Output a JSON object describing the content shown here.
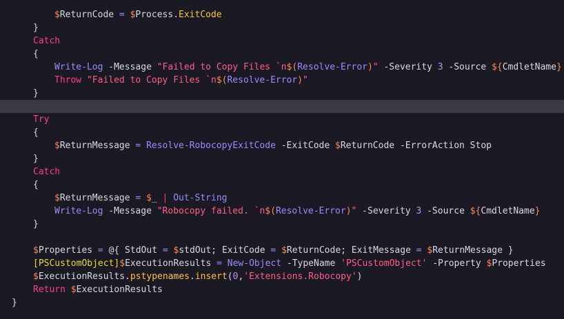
{
  "colors": {
    "background": "#1b1a24",
    "current_line": "#3b3a44",
    "plain": "#d8d8e6",
    "variable": "#ff8a5c",
    "keyword": "#ff3f7f",
    "cmdlet": "#9a8cff",
    "string": "#ff5e88",
    "number": "#c48cff",
    "property": "#ffc246",
    "type": "#e9d83a",
    "operator": "#9a8cff"
  },
  "lines": [
    [
      {
        "t": "$",
        "c": "variable"
      },
      {
        "t": "ReturnCode ",
        "c": "plain"
      },
      {
        "t": "= ",
        "c": "operator"
      },
      {
        "t": "$",
        "c": "variable"
      },
      {
        "t": "Process",
        "c": "plain"
      },
      {
        "t": ".",
        "c": "plain"
      },
      {
        "t": "ExitCode",
        "c": "property"
      }
    ],
    [
      {
        "t": "}",
        "c": "plain"
      }
    ],
    [
      {
        "t": "Catch",
        "c": "keyword"
      }
    ],
    [
      {
        "t": "{",
        "c": "plain"
      }
    ],
    [
      {
        "t": "Write-Log ",
        "c": "cmdlet"
      },
      {
        "t": "-Message ",
        "c": "plain"
      },
      {
        "t": "\"Failed to Copy Files `n",
        "c": "string"
      },
      {
        "t": "$(",
        "c": "variable"
      },
      {
        "t": "Resolve-Error",
        "c": "cmdlet"
      },
      {
        "t": ")",
        "c": "variable"
      },
      {
        "t": "\" ",
        "c": "string"
      },
      {
        "t": "-Severity ",
        "c": "plain"
      },
      {
        "t": "3 ",
        "c": "number"
      },
      {
        "t": "-Source ",
        "c": "plain"
      },
      {
        "t": "${",
        "c": "variable"
      },
      {
        "t": "CmdletName",
        "c": "plain"
      },
      {
        "t": "}",
        "c": "variable"
      }
    ],
    [
      {
        "t": "Throw ",
        "c": "keyword"
      },
      {
        "t": "\"Failed to Copy Files `n",
        "c": "string"
      },
      {
        "t": "$(",
        "c": "variable"
      },
      {
        "t": "Resolve-Error",
        "c": "cmdlet"
      },
      {
        "t": ")",
        "c": "variable"
      },
      {
        "t": "\"",
        "c": "string"
      }
    ],
    [
      {
        "t": "}",
        "c": "plain"
      }
    ],
    [],
    [
      {
        "t": "Try",
        "c": "keyword"
      }
    ],
    [
      {
        "t": "{",
        "c": "plain"
      }
    ],
    [
      {
        "t": "$",
        "c": "variable"
      },
      {
        "t": "ReturnMessage ",
        "c": "plain"
      },
      {
        "t": "= ",
        "c": "operator"
      },
      {
        "t": "Resolve-RobocopyExitCode ",
        "c": "cmdlet"
      },
      {
        "t": "-ExitCode ",
        "c": "plain"
      },
      {
        "t": "$",
        "c": "variable"
      },
      {
        "t": "ReturnCode ",
        "c": "plain"
      },
      {
        "t": "-ErrorAction Stop",
        "c": "plain"
      }
    ],
    [
      {
        "t": "}",
        "c": "plain"
      }
    ],
    [
      {
        "t": "Catch",
        "c": "keyword"
      }
    ],
    [
      {
        "t": "{",
        "c": "plain"
      }
    ],
    [
      {
        "t": "$",
        "c": "variable"
      },
      {
        "t": "ReturnMessage ",
        "c": "plain"
      },
      {
        "t": "= ",
        "c": "operator"
      },
      {
        "t": "$",
        "c": "variable"
      },
      {
        "t": "_ ",
        "c": "plain"
      },
      {
        "t": "| ",
        "c": "keyword"
      },
      {
        "t": "Out-String",
        "c": "cmdlet"
      }
    ],
    [
      {
        "t": "Write-Log ",
        "c": "cmdlet"
      },
      {
        "t": "-Message ",
        "c": "plain"
      },
      {
        "t": "\"Robocopy failed. `n",
        "c": "string"
      },
      {
        "t": "$(",
        "c": "variable"
      },
      {
        "t": "Resolve-Error",
        "c": "cmdlet"
      },
      {
        "t": ")",
        "c": "variable"
      },
      {
        "t": "\" ",
        "c": "string"
      },
      {
        "t": "-Severity ",
        "c": "plain"
      },
      {
        "t": "3 ",
        "c": "number"
      },
      {
        "t": "-Source ",
        "c": "plain"
      },
      {
        "t": "${",
        "c": "variable"
      },
      {
        "t": "CmdletName",
        "c": "plain"
      },
      {
        "t": "}",
        "c": "variable"
      }
    ],
    [
      {
        "t": "}",
        "c": "plain"
      }
    ],
    [],
    [
      {
        "t": "$",
        "c": "variable"
      },
      {
        "t": "Properties ",
        "c": "plain"
      },
      {
        "t": "= ",
        "c": "operator"
      },
      {
        "t": "@{ StdOut ",
        "c": "plain"
      },
      {
        "t": "= ",
        "c": "operator"
      },
      {
        "t": "$",
        "c": "variable"
      },
      {
        "t": "stdOut; ExitCode ",
        "c": "plain"
      },
      {
        "t": "= ",
        "c": "operator"
      },
      {
        "t": "$",
        "c": "variable"
      },
      {
        "t": "ReturnCode; ExitMessage ",
        "c": "plain"
      },
      {
        "t": "= ",
        "c": "operator"
      },
      {
        "t": "$",
        "c": "variable"
      },
      {
        "t": "ReturnMessage }",
        "c": "plain"
      }
    ],
    [
      {
        "t": "[PSCustomObject]",
        "c": "type"
      },
      {
        "t": "$",
        "c": "variable"
      },
      {
        "t": "ExecutionResults ",
        "c": "plain"
      },
      {
        "t": "= ",
        "c": "operator"
      },
      {
        "t": "New-Object ",
        "c": "cmdlet"
      },
      {
        "t": "-TypeName ",
        "c": "plain"
      },
      {
        "t": "'PSCustomObject' ",
        "c": "string"
      },
      {
        "t": "-Property ",
        "c": "plain"
      },
      {
        "t": "$",
        "c": "variable"
      },
      {
        "t": "Properties",
        "c": "plain"
      }
    ],
    [
      {
        "t": "$",
        "c": "variable"
      },
      {
        "t": "ExecutionResults",
        "c": "plain"
      },
      {
        "t": ".",
        "c": "plain"
      },
      {
        "t": "pstypenames",
        "c": "property"
      },
      {
        "t": ".",
        "c": "plain"
      },
      {
        "t": "insert",
        "c": "property"
      },
      {
        "t": "(",
        "c": "plain"
      },
      {
        "t": "0",
        "c": "number"
      },
      {
        "t": ",",
        "c": "plain"
      },
      {
        "t": "'Extensions.Robocopy'",
        "c": "string"
      },
      {
        "t": ")",
        "c": "plain"
      }
    ],
    [
      {
        "t": "Return ",
        "c": "keyword"
      },
      {
        "t": "$",
        "c": "variable"
      },
      {
        "t": "ExecutionResults",
        "c": "plain"
      }
    ],
    [
      {
        "t": "}",
        "c": "plain"
      }
    ]
  ]
}
